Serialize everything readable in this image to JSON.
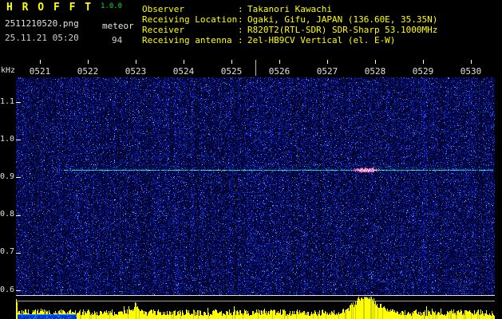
{
  "app": {
    "title": "H R O F F T",
    "version": "1.0.0"
  },
  "capture": {
    "filename": "2511210520.png",
    "mode": "meteor",
    "datetime": "25.11.21 05:20",
    "echo_count": "94"
  },
  "header": {
    "separator": ":",
    "rows": [
      {
        "label": "Observer",
        "value": "Takanori Kawachi"
      },
      {
        "label": "Receiving Location",
        "value": "Ogaki, Gifu, JAPAN (136.60E, 35.35N)"
      },
      {
        "label": "Receiver",
        "value": "R820T2(RTL-SDR) SDR-Sharp 53.1000MHz"
      },
      {
        "label": "Receiving antenna",
        "value": "2el-HB9CV Vertical (el. E-W)"
      }
    ]
  },
  "chart_data": {
    "type": "heatmap",
    "title": "HROFFT radio meteor observation spectrogram (10-minute waterfall)",
    "ylabel": "kHz",
    "y_ticks": [
      "1.1",
      "1.0",
      "0.9",
      "0.8",
      "0.7",
      "0.6"
    ],
    "x_ticks": [
      "0521",
      "0522",
      "0523",
      "0524",
      "0525",
      "0526",
      "0527",
      "0528",
      "0529",
      "0530"
    ],
    "y_range_khz": [
      0.58,
      1.17
    ],
    "x_range_time": [
      "05:20",
      "05:30"
    ],
    "carrier_line_khz": 0.92,
    "meteor_echo": {
      "time_min_after_0500": 27.8,
      "khz": 0.92
    },
    "bottom_strip": "yellow signal-level bars with a spike at the meteor echo time and blue level block at left",
    "palette": {
      "noise_dark": "#000020",
      "noise_mid": "#0020a0",
      "noise_bright": "#4060ff",
      "carrier_line": "#00e0e0",
      "echo_pink": "#ff7ad1",
      "echo_white": "#ffffff",
      "level_bars": "#ffff00",
      "level_block": "#0030dd",
      "axis_text": "#e0e0e0",
      "header_text": "#ffff00",
      "title_text": "#ffff00",
      "version_text": "#00dd44"
    }
  }
}
